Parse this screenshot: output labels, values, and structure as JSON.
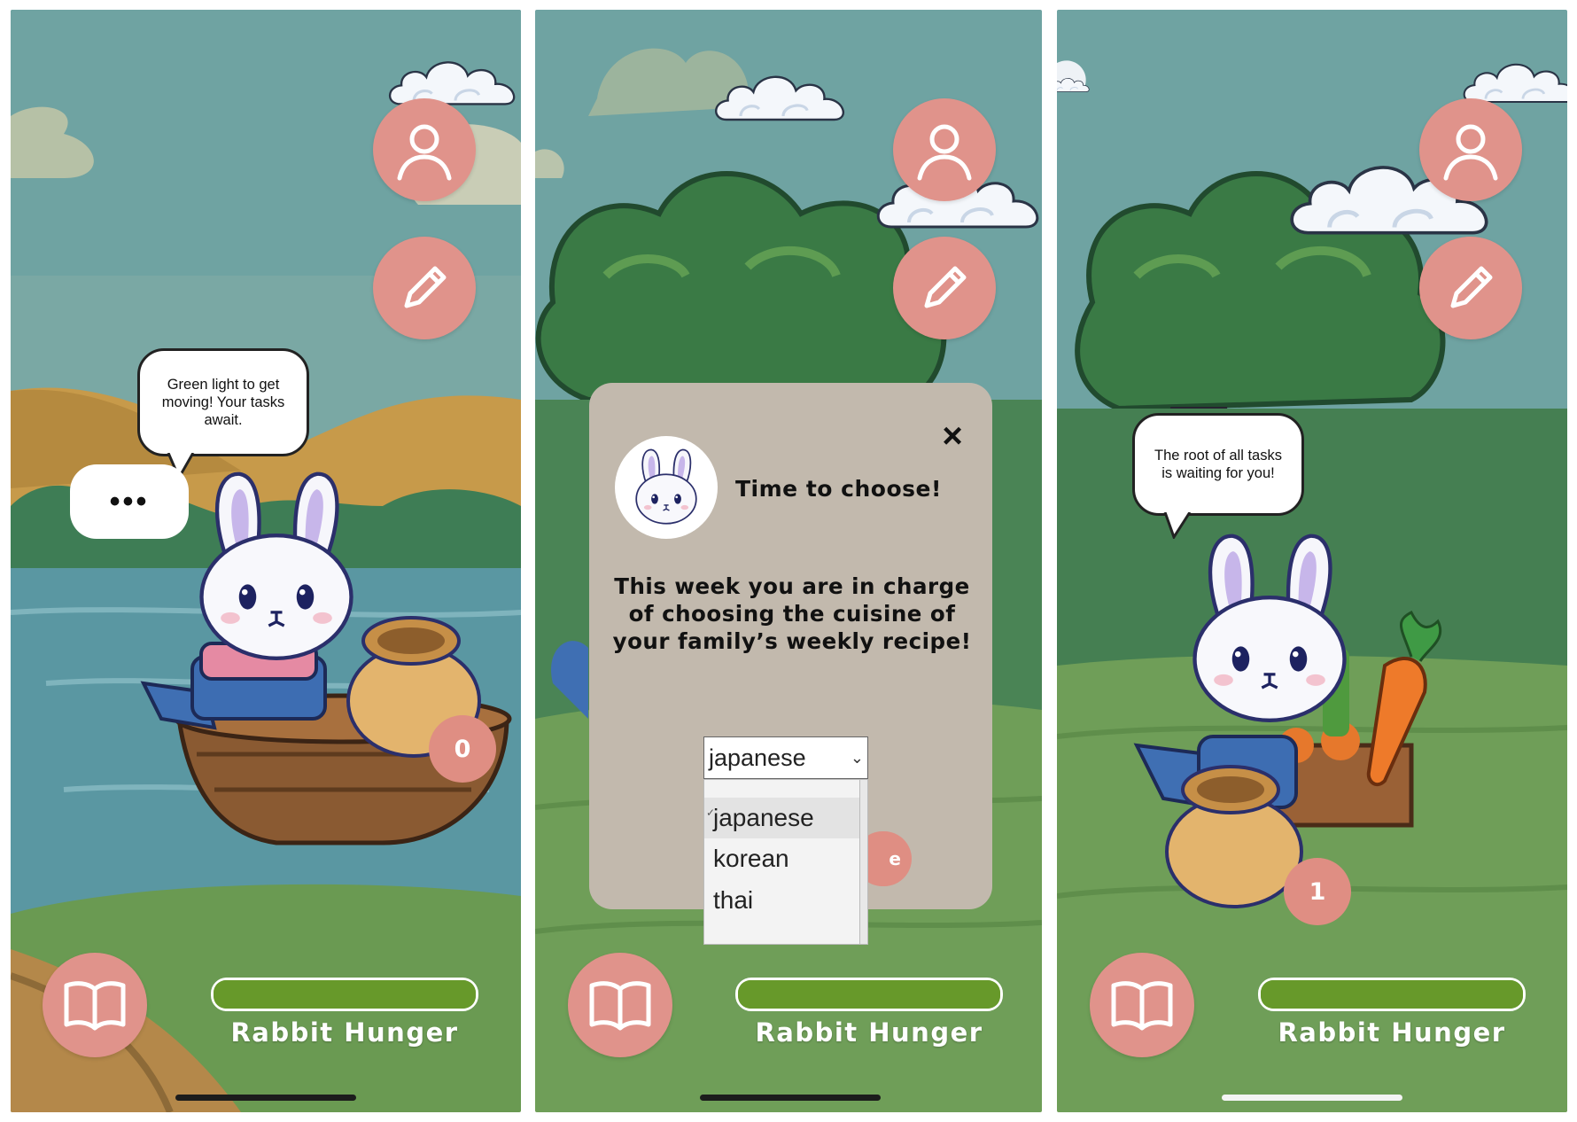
{
  "screens": [
    {
      "speech_text": "Green light to get moving! Your tasks await.",
      "thinking_text": "•••",
      "bag_count": "0",
      "hunger_label": "Rabbit Hunger",
      "hunger_level": 1.0
    },
    {
      "dialog": {
        "title": "Time to choose!",
        "message": "This week you are in charge of choosing the cuisine of your family’s weekly recipe!",
        "close_icon": "×",
        "select_value": "japanese",
        "options": [
          "japanese",
          "korean",
          "thai"
        ],
        "selected_option": "japanese",
        "hidden_button_partial": "e"
      },
      "hunger_label": "Rabbit Hunger",
      "hunger_level": 1.0
    },
    {
      "speech_text": "The root of all tasks is waiting for you!",
      "bag_count": "1",
      "hunger_label": "Rabbit Hunger",
      "hunger_level": 1.0
    }
  ],
  "icons": {
    "profile": "user-icon",
    "edit": "pencil-icon",
    "journal": "book-icon"
  },
  "colors": {
    "button": "#e0938b",
    "hunger_bar": "#67992a",
    "dialog": "#c2b9ad"
  }
}
